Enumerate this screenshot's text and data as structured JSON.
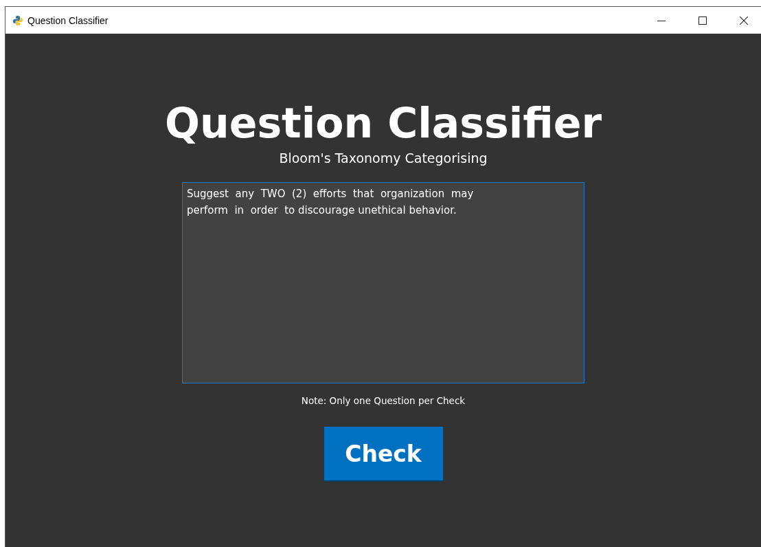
{
  "window": {
    "title": "Question Classifier"
  },
  "heading": "Question Classifier",
  "subtitle": "Bloom's Taxonomy Categorising",
  "question_field": {
    "value": "Suggest  any  TWO  (2)  efforts  that  organization  may\nperform  in  order  to discourage unethical behavior.",
    "focused": true
  },
  "note": "Note: Only one Question per Check",
  "check_button": "Check"
}
